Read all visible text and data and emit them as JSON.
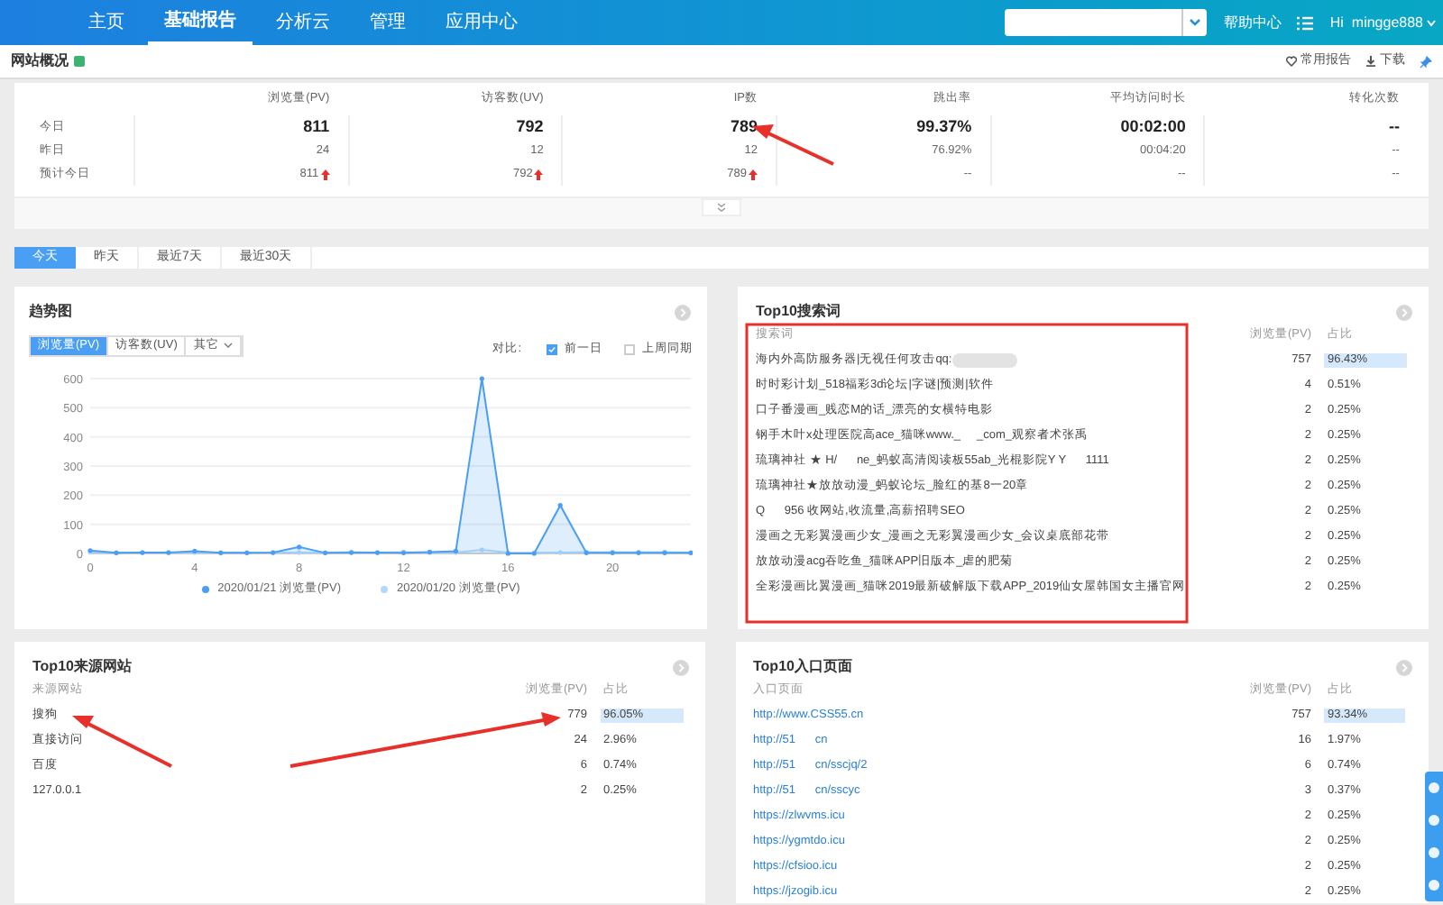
{
  "nav": {
    "items": [
      {
        "label": "主页",
        "selected": false
      },
      {
        "label": "基础报告",
        "selected": true
      },
      {
        "label": "分析云",
        "selected": false
      },
      {
        "label": "管理",
        "selected": false
      },
      {
        "label": "应用中心",
        "selected": false
      }
    ],
    "help": "帮助中心",
    "user": "Hi  mingge888"
  },
  "page_header": {
    "title": "网站概况",
    "links": [
      "常用报告",
      "下载"
    ]
  },
  "overview": {
    "columns": [
      "浏览量(PV)",
      "访客数(UV)",
      "IP数",
      "跳出率",
      "平均访问时长",
      "转化次数"
    ],
    "rows": [
      {
        "label": "今日",
        "kind": "main",
        "cells": [
          {
            "text": "811"
          },
          {
            "text": "792"
          },
          {
            "text": "789"
          },
          {
            "text": "99.37%"
          },
          {
            "text": "00:02:00"
          },
          {
            "text": "--"
          }
        ]
      },
      {
        "label": "昨日",
        "kind": "normal",
        "cells": [
          {
            "text": "24"
          },
          {
            "text": "12"
          },
          {
            "text": "12"
          },
          {
            "text": "76.92%"
          },
          {
            "text": "00:04:20"
          },
          {
            "text": "--"
          }
        ]
      },
      {
        "label": "预计今日",
        "kind": "normal",
        "cells": [
          {
            "text": "811",
            "up_arrow": true
          },
          {
            "text": "792",
            "up_arrow": true
          },
          {
            "text": "789",
            "up_arrow": true
          },
          {
            "text": "--"
          },
          {
            "text": "--"
          },
          {
            "text": "--"
          }
        ]
      }
    ]
  },
  "range_tabs": [
    {
      "label": "今天",
      "selected": true
    },
    {
      "label": "昨天",
      "selected": false
    },
    {
      "label": "最近7天",
      "selected": false
    },
    {
      "label": "最近30天",
      "selected": false
    }
  ],
  "trend": {
    "title": "趋势图",
    "metric_tabs": [
      {
        "label": "浏览量(PV)",
        "selected": true
      },
      {
        "label": "访客数(UV)",
        "selected": false
      },
      {
        "label": "其它",
        "selected": false
      }
    ],
    "compare_label": "对比:",
    "compare": [
      {
        "label": "前一日",
        "checked": true
      },
      {
        "label": "上周同期",
        "checked": false
      }
    ],
    "chart_data": {
      "type": "line",
      "grid": true,
      "xlim": [
        0,
        23
      ],
      "x": [
        0,
        1,
        2,
        3,
        4,
        5,
        6,
        7,
        8,
        9,
        10,
        11,
        12,
        13,
        14,
        15,
        16,
        17,
        18,
        19,
        20,
        21,
        22,
        23
      ],
      "xticks": [
        0,
        4,
        8,
        12,
        16,
        20
      ],
      "yticks": [
        0,
        100,
        200,
        300,
        400,
        500,
        600
      ],
      "ylim": [
        0,
        600
      ],
      "series": [
        {
          "name": "2020/01/21 浏览量(PV)",
          "type": "area",
          "color": "#4a9ff5",
          "values": [
            10,
            2,
            3,
            3,
            8,
            2,
            2,
            3,
            22,
            2,
            3,
            3,
            2,
            5,
            8,
            600,
            0,
            0,
            165,
            2,
            2,
            2,
            2,
            2
          ]
        },
        {
          "name": "2020/01/20 浏览量(PV)",
          "type": "line",
          "color": "#b3d8fb",
          "values": [
            4,
            3,
            3,
            3,
            3,
            3,
            3,
            3,
            3,
            3,
            5,
            3,
            5,
            3,
            3,
            12,
            3,
            3,
            3,
            5,
            5,
            5,
            5,
            3
          ]
        }
      ]
    }
  },
  "top_keywords": {
    "title": "Top10搜索词",
    "columns": [
      "搜索词",
      "浏览量(PV)",
      "占比"
    ],
    "rows": [
      {
        "term": "海内外高防服务器|无视任何攻击qq:",
        "blurred": true,
        "pv": "757",
        "share": "96.43%",
        "level": 0.9643
      },
      {
        "term": "时时彩计划_518福彩3d论坛|字谜|预测|软件",
        "pv": "4",
        "share": "0.51%"
      },
      {
        "term": "口子番漫画_贱恋M的话_漂亮的女横特电影",
        "pv": "2",
        "share": "0.25%"
      },
      {
        "term": "钢手木叶x处理医院高ace_猫咪www._     _com_观察者术张禹",
        "pv": "2",
        "share": "0.25%"
      },
      {
        "term": "琉璃神社 ★ H/      ne_蚂蚁高清阅读板55ab_光棍影院Y Y      1111",
        "pv": "2",
        "share": "0.25%"
      },
      {
        "term": "琉璃神社★放放动漫_蚂蚁论坛_脸红的基8一20章",
        "pv": "2",
        "share": "0.25%"
      },
      {
        "term": "Q      956 收网站,收流量,高薪招聘SEO",
        "pv": "2",
        "share": "0.25%"
      },
      {
        "term": "漫画之无彩翼漫画少女_漫画之无彩翼漫画少女_会议桌底部花带",
        "pv": "2",
        "share": "0.25%"
      },
      {
        "term": "放放动漫acg吞吃鱼_猫咪APP旧版本_虐的肥菊",
        "pv": "2",
        "share": "0.25%"
      },
      {
        "term": "全彩漫画比翼漫画_猫咪2019最新破解版下载APP_2019仙女屋韩国女主播官网",
        "pv": "2",
        "share": "0.25%"
      }
    ]
  },
  "top_sources": {
    "title": "Top10来源网站",
    "columns": [
      "来源网站",
      "浏览量(PV)",
      "占比"
    ],
    "rows": [
      {
        "term": "搜狗",
        "pv": "779",
        "share": "96.05%",
        "level": 0.9605
      },
      {
        "term": "直接访问",
        "pv": "24",
        "share": "2.96%"
      },
      {
        "term": "百度",
        "pv": "6",
        "share": "0.74%"
      },
      {
        "term": "127.0.0.1",
        "pv": "2",
        "share": "0.25%"
      }
    ]
  },
  "top_entries": {
    "title": "Top10入口页面",
    "columns": [
      "入口页面",
      "浏览量(PV)",
      "占比"
    ],
    "rows": [
      {
        "term": "http://www.CSS55.cn",
        "pv": "757",
        "share": "93.34%",
        "level": 0.9334
      },
      {
        "term": "http://51      cn",
        "pv": "16",
        "share": "1.97%"
      },
      {
        "term": "http://51      cn/sscjq/2",
        "pv": "6",
        "share": "0.74%"
      },
      {
        "term": "http://51      cn/sscyc",
        "pv": "3",
        "share": "0.37%"
      },
      {
        "term": "https://zlwvms.icu",
        "pv": "2",
        "share": "0.25%"
      },
      {
        "term": "https://ygmtdo.icu",
        "pv": "2",
        "share": "0.25%"
      },
      {
        "term": "https://cfsioo.icu",
        "pv": "2",
        "share": "0.25%"
      },
      {
        "term": "https://jzogib.icu",
        "pv": "2",
        "share": "0.25%"
      }
    ]
  }
}
